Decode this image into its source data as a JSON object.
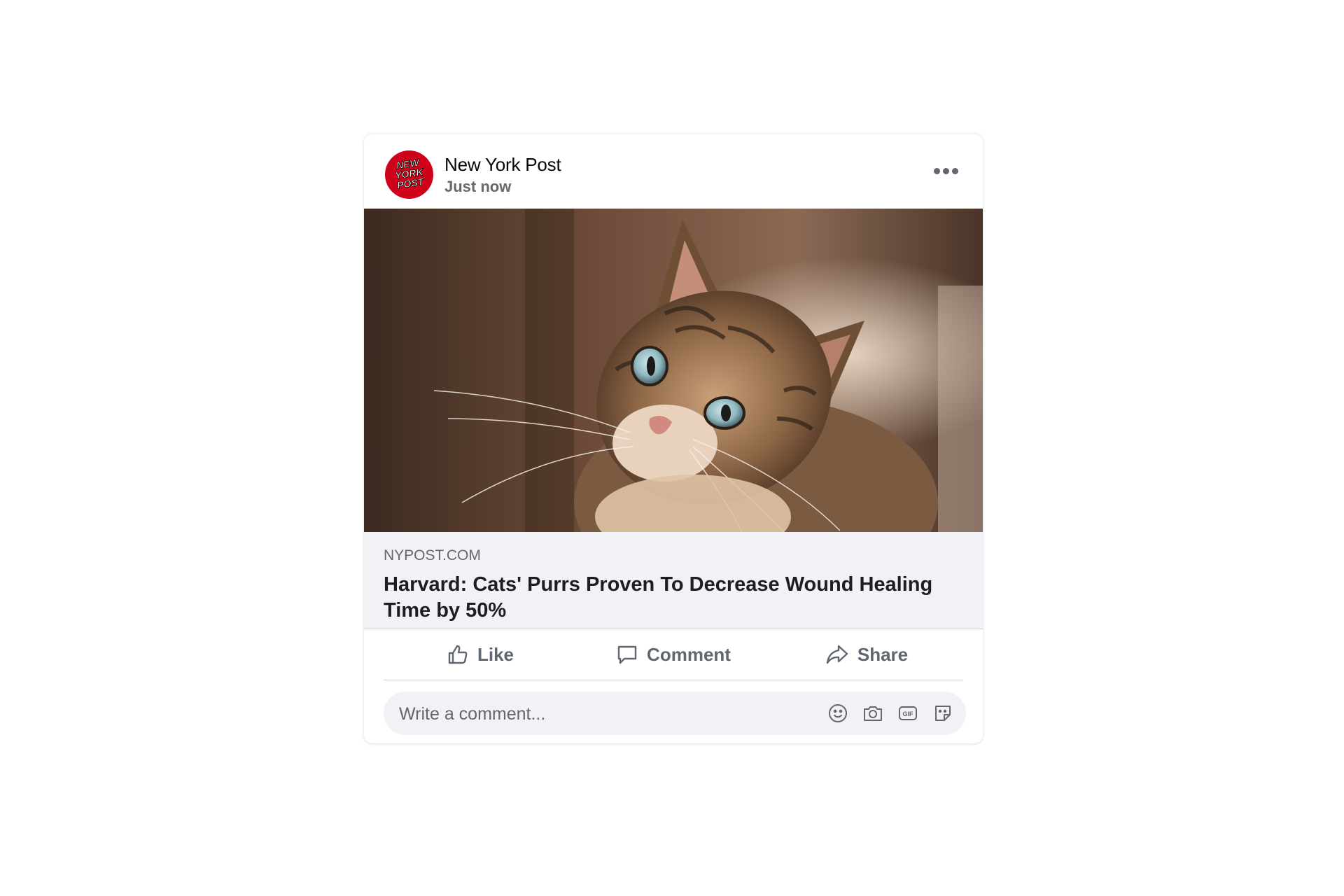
{
  "post": {
    "page_name": "New York Post",
    "timestamp": "Just now",
    "avatar_text": "NEW YORK POST",
    "photo_subject": "tabby-cat-photo"
  },
  "link": {
    "domain": "NYPOST.COM",
    "title": "Harvard: Cats' Purrs Proven To Decrease Wound Healing Time by 50%"
  },
  "actions": {
    "like_label": "Like",
    "comment_label": "Comment",
    "share_label": "Share"
  },
  "comment": {
    "placeholder": "Write a comment..."
  },
  "colors": {
    "avatar_red": "#d0021b",
    "preview_bg": "#f0f2f5",
    "muted_text": "#65676b"
  }
}
